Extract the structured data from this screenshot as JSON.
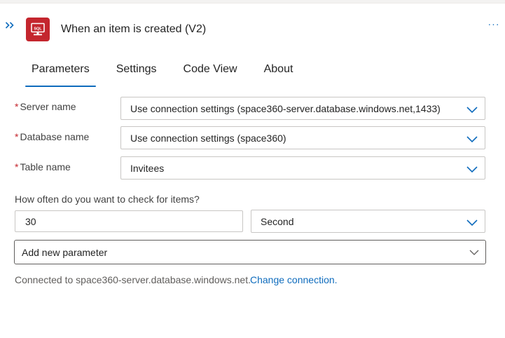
{
  "header": {
    "expand_icon": "double-chevron-right-icon",
    "app_icon": "sql-server-icon",
    "app_icon_text": "SQL",
    "title": "When an item is created (V2)",
    "more_label": "···",
    "accent": "#0f6cbd",
    "brand": "#c4262e"
  },
  "tabs": [
    {
      "label": "Parameters",
      "active": true
    },
    {
      "label": "Settings",
      "active": false
    },
    {
      "label": "Code View",
      "active": false
    },
    {
      "label": "About",
      "active": false
    }
  ],
  "fields": {
    "server": {
      "required": "*",
      "label": "Server name",
      "value": "Use connection settings (space360-server.database.windows.net,1433)"
    },
    "database": {
      "required": "*",
      "label": "Database name",
      "value": "Use connection settings (space360)"
    },
    "table": {
      "required": "*",
      "label": "Table name",
      "value": "Invitees"
    },
    "frequency": {
      "label": "How often do you want to check for items?",
      "interval": "30",
      "unit": "Second"
    },
    "add_parameter": {
      "placeholder": "Add new parameter"
    }
  },
  "footer": {
    "status": "Connected to space360-server.database.windows.net.",
    "change_link": "Change connection."
  }
}
